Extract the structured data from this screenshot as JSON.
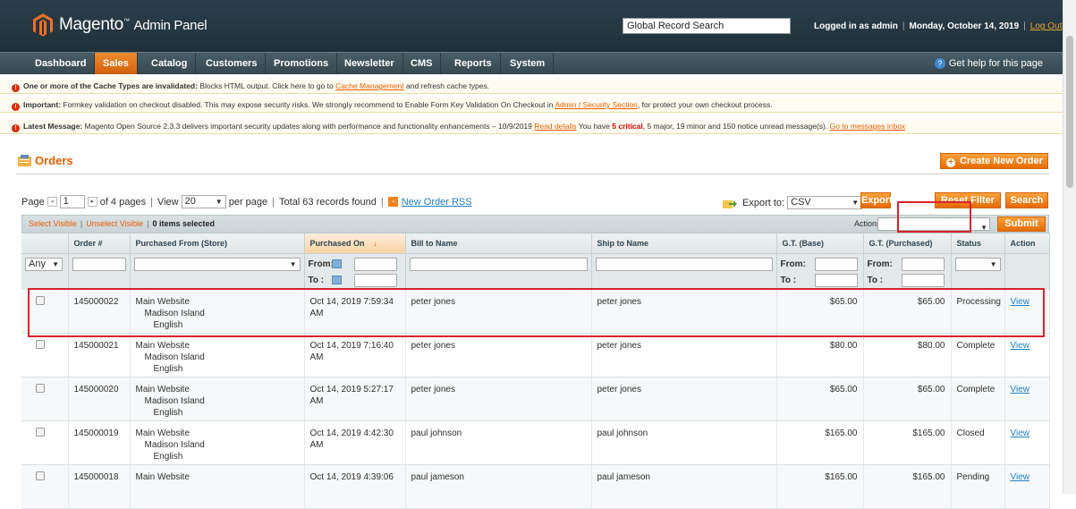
{
  "header": {
    "brand": "Magento",
    "brand_suffix": "Admin Panel",
    "search_value": "Global Record Search",
    "logged_in": "Logged in as admin",
    "date": "Monday, October 14, 2019",
    "logout": "Log Out"
  },
  "nav": {
    "items": [
      "Dashboard",
      "Sales",
      "Catalog",
      "Customers",
      "Promotions",
      "Newsletter",
      "CMS",
      "Reports",
      "System"
    ],
    "help": "Get help for this page"
  },
  "messages": {
    "m1_bold": "One or more of the Cache Types are invalidated:",
    "m1_text": " Blocks HTML output. Click here to go to ",
    "m1_link": "Cache Management",
    "m1_tail": " and refresh cache types.",
    "m2_bold": "Important:",
    "m2_text": " Formkey validation on checkout disabled. This may expose security risks. We strongly recommend to Enable Form Key Validation On Checkout in ",
    "m2_link": "Admin / Security Section",
    "m2_tail": ", for protect your own checkout process.",
    "m3_bold": "Latest Message:",
    "m3_text": " Magento Open Source 2.3.3 delivers important security updates along with performance and functionality enhancements – 10/9/2019 ",
    "m3_link": "Read details",
    "m3_t1": " You have ",
    "m3_critical": "5 critical",
    "m3_t2": ", 5 major, 19 minor and 150 notice unread message(s). ",
    "m3_link2": "Go to messages inbox"
  },
  "page": {
    "title": "Orders",
    "create_button": "Create New Order"
  },
  "pager": {
    "page_label": "Page",
    "page_value": "1",
    "of_pages": "of 4 pages",
    "view_label": "View",
    "view_value": "20",
    "per_page": "per page",
    "total": "Total 63 records found",
    "rss": "New Order RSS",
    "export_label": "Export to:",
    "export_value": "CSV",
    "export_button": "Export",
    "reset_button": "Reset Filter",
    "search_button": "Search"
  },
  "massaction": {
    "select_visible": "Select Visible",
    "unselect_visible": "Unselect Visible",
    "selected": "0 items selected",
    "actions_label": "Actions",
    "submit": "Submit"
  },
  "columns": [
    "",
    "Order #",
    "Purchased From (Store)",
    "Purchased On",
    "Bill to Name",
    "Ship to Name",
    "G.T. (Base)",
    "G.T. (Purchased)",
    "Status",
    "Action"
  ],
  "filter": {
    "any": "Any",
    "from": "From:",
    "to": "To :"
  },
  "rows": [
    {
      "order": "145000022",
      "store1": "Main Website",
      "store2": "Madison Island",
      "store3": "English",
      "date1": "Oct 14, 2019 7:59:34",
      "date2": "AM",
      "bill": "peter jones",
      "ship": "peter jones",
      "base": "$65.00",
      "purchased": "$65.00",
      "status": "Processing",
      "action": "View"
    },
    {
      "order": "145000021",
      "store1": "Main Website",
      "store2": "Madison Island",
      "store3": "English",
      "date1": "Oct 14, 2019 7:16:40",
      "date2": "AM",
      "bill": "peter jones",
      "ship": "peter jones",
      "base": "$80.00",
      "purchased": "$80.00",
      "status": "Complete",
      "action": "View"
    },
    {
      "order": "145000020",
      "store1": "Main Website",
      "store2": "Madison Island",
      "store3": "English",
      "date1": "Oct 14, 2019 5:27:17",
      "date2": "AM",
      "bill": "peter jones",
      "ship": "peter jones",
      "base": "$65.00",
      "purchased": "$65.00",
      "status": "Complete",
      "action": "View"
    },
    {
      "order": "145000019",
      "store1": "Main Website",
      "store2": "Madison Island",
      "store3": "English",
      "date1": "Oct 14, 2019 4:42:30",
      "date2": "AM",
      "bill": "paul johnson",
      "ship": "paul johnson",
      "base": "$165.00",
      "purchased": "$165.00",
      "status": "Closed",
      "action": "View"
    },
    {
      "order": "145000018",
      "store1": "Main Website",
      "store2": "",
      "store3": "",
      "date1": "Oct 14, 2019 4:39:06",
      "date2": "",
      "bill": "paul jameson",
      "ship": "paul jameson",
      "base": "$165.00",
      "purchased": "$165.00",
      "status": "Pending",
      "action": "View"
    }
  ]
}
